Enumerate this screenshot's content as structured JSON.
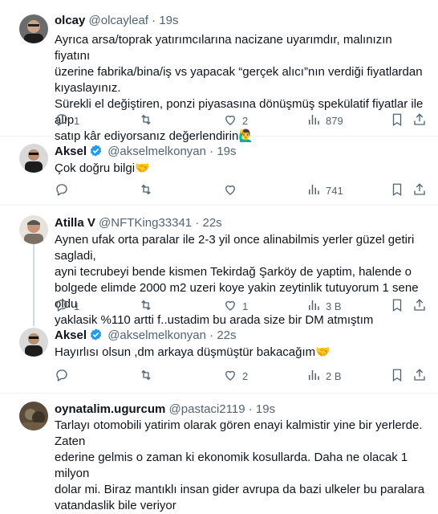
{
  "tweets": [
    {
      "name": "olcay",
      "handle": "@olcayleaf",
      "time": "19s",
      "verified": false,
      "text": "Ayrıca arsa/toprak yatırımcılarına nacizane uyarımdır, malınızın fiyatını\nüzerine fabrika/bina/iş vs yapacak “gerçek alıcı”nın verdiği fiyatlardan\nkıyaslayınız.\nSürekli el değiştiren, ponzi piyasasına dönüşmüş spekülatif fiyatlar ile alıp\nsatıp kâr ediyorsanız değerlendirin",
      "emoji": "🙋‍♂️",
      "replies": "1",
      "retweets": "",
      "likes": "2",
      "views": "879"
    },
    {
      "name": "Aksel",
      "handle": "@akselmelkonyan",
      "time": "19s",
      "verified": true,
      "text": "Çok doğru bilgi",
      "emoji": "🤝",
      "replies": "",
      "retweets": "",
      "likes": "",
      "views": "741"
    },
    {
      "name": "Atilla V",
      "handle": "@NFTKing33341",
      "time": "22s",
      "verified": false,
      "text": "Aynen ufak orta paralar ile 2-3 yil once alinabilmis yerler güzel getiri sagladi,\nayni tecrubeyi bende kismen Tekirdağ Şarköy de yaptim, halende o\nbolgede elimde 2000 m2 uzeri koye yakin zeytinlik tutuyorum 1 sene oldu\nyaklasik %110 artti f..ustadim bu arada size bir DM atmıştım",
      "emoji": "",
      "replies": "1",
      "retweets": "",
      "likes": "1",
      "views": "3 B"
    },
    {
      "name": "Aksel",
      "handle": "@akselmelkonyan",
      "time": "22s",
      "verified": true,
      "text": "Hayırlısı olsun ,dm arkaya düşmüştür bakacağım",
      "emoji": "🤝",
      "replies": "",
      "retweets": "",
      "likes": "2",
      "views": "2 B"
    },
    {
      "name": "oynatalim.ugurcum",
      "handle": "@pastaci2119",
      "time": "19s",
      "verified": false,
      "text": "Tarlayı otomobili yatirim olarak gören enayi kalmistir yine bir yerlerde. Zaten\nederine gelmis o zaman ki ekonomik kosullarda. Daha ne olacak 1 milyon\ndolar mi. Biraz mantıklı insan gider avrupa da bazi ulkeler bu paralara\nvatandaslik bile veriyor",
      "emoji": "",
      "replies": "",
      "retweets": "",
      "likes": "",
      "views": ""
    }
  ],
  "colors": {
    "text": "#0f1419",
    "secondary": "#536471",
    "verified": "#1d9bf0",
    "border": "#eff3f4",
    "thread": "#cfd9de"
  },
  "icons": [
    "reply-icon",
    "retweet-icon",
    "like-icon",
    "views-icon",
    "bookmark-icon",
    "share-icon",
    "verified-badge-icon"
  ]
}
